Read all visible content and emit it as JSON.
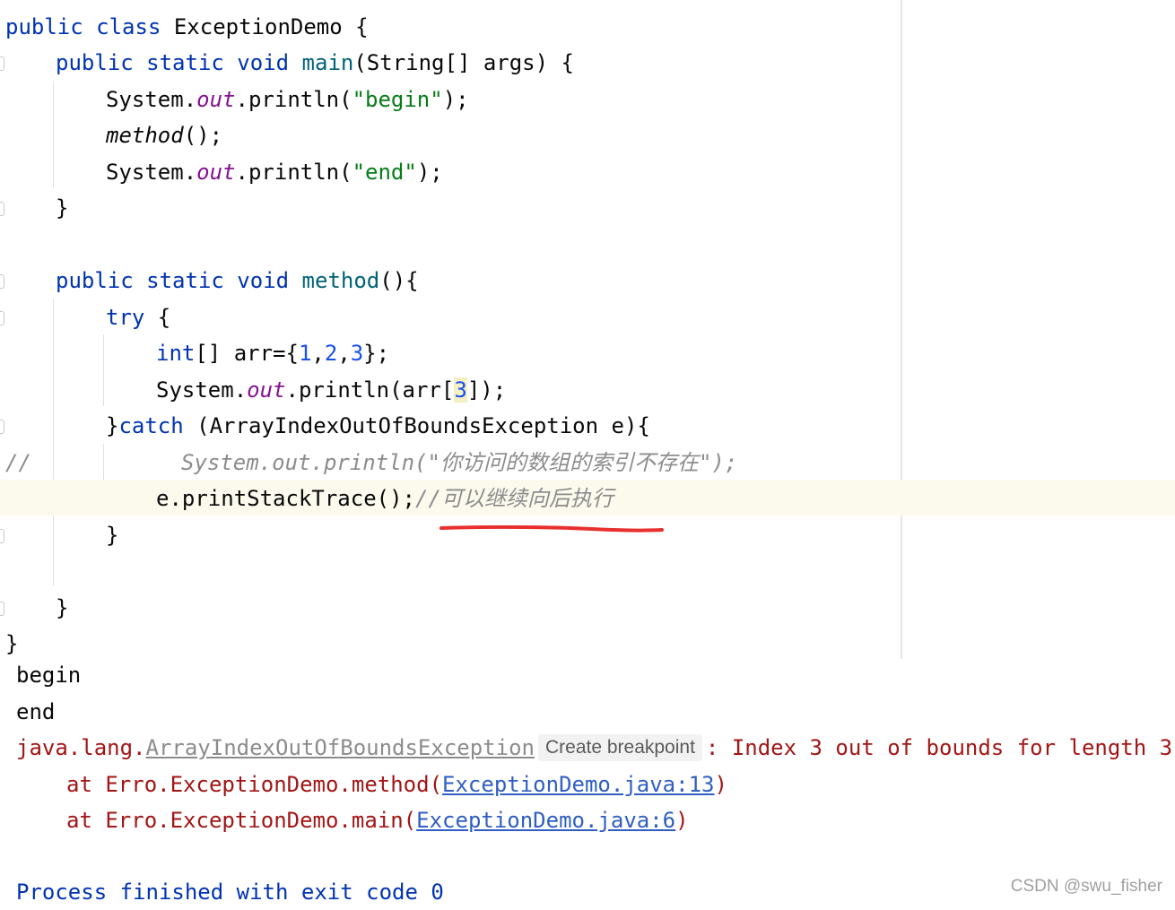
{
  "editor": {
    "lines": [
      {
        "t1": "public class ",
        "t2": "ExceptionDemo {"
      },
      {
        "t1": "public static void ",
        "t2": "main",
        "t3": "(String[] args) {"
      },
      {
        "t1": "System.",
        "t2": "out",
        "t3": ".println(",
        "t4": "\"begin\"",
        "t5": ");"
      },
      {
        "t1": "method",
        "t2": "();"
      },
      {
        "t1": "System.",
        "t2": "out",
        "t3": ".println(",
        "t4": "\"end\"",
        "t5": ");"
      },
      {
        "t1": "}"
      },
      {
        "t1": "public static void ",
        "t2": "method",
        "t3": "(){"
      },
      {
        "t1": "try",
        "t2": " {"
      },
      {
        "t1": "int",
        "t2": "[] arr={",
        "n1": "1",
        "c1": ",",
        "n2": "2",
        "c2": ",",
        "n3": "3",
        "t3": "};"
      },
      {
        "t1": "System.",
        "t2": "out",
        "t3": ".println(arr[",
        "n1": "3",
        "t4": "]);"
      },
      {
        "t1": "}",
        "t2": "catch",
        "t3": " (ArrayIndexOutOfBoundsException e){"
      },
      {
        "t1": "//",
        "t2": "System.out.println(\"你访问的数组的索引不存在\");"
      },
      {
        "t1": "e.printStackTrace();",
        "t2": "//可以继续向后执行"
      },
      {
        "t1": "}"
      },
      {
        "t1": "}"
      },
      {
        "t1": "}"
      }
    ]
  },
  "console": {
    "line_begin": "begin",
    "line_end": "end",
    "ex_prefix": "java.lang.",
    "ex_class": "ArrayIndexOutOfBoundsException",
    "tooltip": "Create breakpoint",
    "ex_msg": ": Index 3 out of bounds for length 3",
    "at1_pre": "at Erro.ExceptionDemo.method(",
    "at1_link": "ExceptionDemo.java:13",
    "at1_post": ")",
    "at2_pre": "at Erro.ExceptionDemo.main(",
    "at2_link": "ExceptionDemo.java:6",
    "at2_post": ")",
    "process": "Process finished with exit code 0"
  },
  "watermark": "CSDN @swu_fisher",
  "colors": {
    "keyword": "#0033b3",
    "string": "#067d17",
    "field": "#871094",
    "number": "#1750eb",
    "comment": "#8c8c8c",
    "error": "#a31515",
    "link": "#2f5ec4",
    "annotation_underline": "#e8302f"
  }
}
